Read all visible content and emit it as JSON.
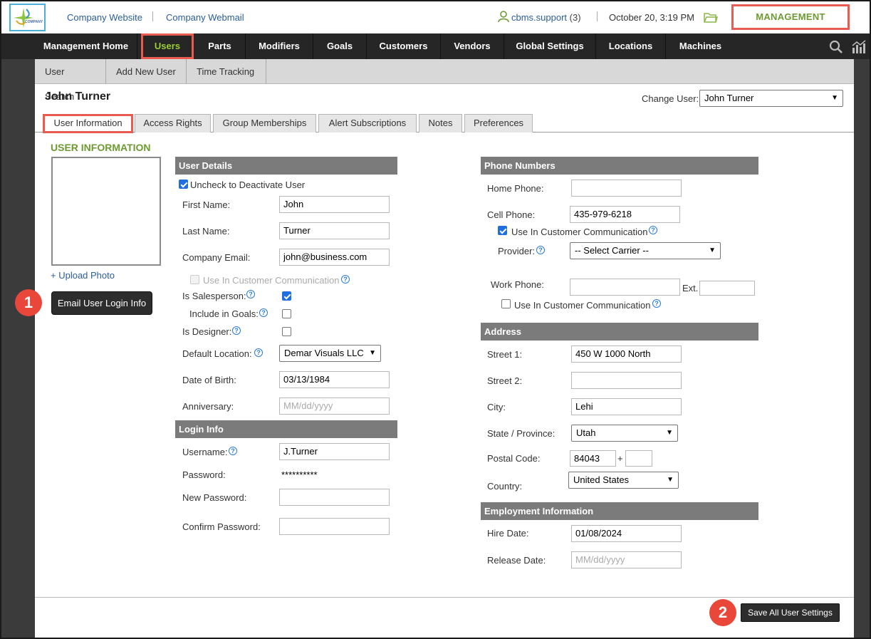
{
  "top": {
    "links": [
      "Company Website",
      "Company Webmail"
    ],
    "user": "cbms.support",
    "user_count": "(3)",
    "datetime": "October 20, 3:19 PM",
    "mode": "MANAGEMENT",
    "logo_text": "COMPANY"
  },
  "nav": {
    "items": [
      "Management Home",
      "Users",
      "Parts",
      "Modifiers",
      "Goals",
      "Customers",
      "Vendors",
      "Global Settings",
      "Locations",
      "Machines"
    ],
    "active": "Users"
  },
  "subnav": [
    "User Search",
    "Add New User",
    "Time Tracking"
  ],
  "page": {
    "user_name": "John Turner",
    "change_user_label": "Change User:",
    "change_user_value": "John Turner"
  },
  "tabs": [
    "User Information",
    "Access Rights",
    "Group Memberships",
    "Alert Subscriptions",
    "Notes",
    "Preferences"
  ],
  "left": {
    "heading": "USER INFORMATION",
    "upload": "+ Upload Photo",
    "email_button": "Email User Login Info"
  },
  "user_details": {
    "title": "User Details",
    "deactivate_label": "Uncheck to Deactivate User",
    "first_name_label": "First Name:",
    "first_name": "John",
    "last_name_label": "Last Name:",
    "last_name": "Turner",
    "email_label": "Company Email:",
    "email": "john@business.com",
    "use_comm_label": "Use In Customer Communication",
    "salesperson_label": "Is Salesperson:",
    "goals_label": "Include in Goals:",
    "designer_label": "Is Designer:",
    "location_label": "Default Location:",
    "location": "Demar Visuals LLC",
    "dob_label": "Date of Birth:",
    "dob": "03/13/1984",
    "anniv_label": "Anniversary:",
    "anniv_placeholder": "MM/dd/yyyy"
  },
  "login_info": {
    "title": "Login Info",
    "username_label": "Username:",
    "username": "J.Turner",
    "password_label": "Password:",
    "password": "**********",
    "new_password_label": "New Password:",
    "confirm_password_label": "Confirm Password:"
  },
  "phone": {
    "title": "Phone Numbers",
    "home_label": "Home Phone:",
    "cell_label": "Cell Phone:",
    "cell": "435-979-6218",
    "use_comm_label": "Use In Customer Communication",
    "provider_label": "Provider:",
    "provider": "-- Select Carrier --",
    "work_label": "Work Phone:",
    "ext_label": "Ext.",
    "work_use_comm_label": "Use In Customer Communication"
  },
  "address": {
    "title": "Address",
    "street1_label": "Street 1:",
    "street1": "450 W 1000 North",
    "street2_label": "Street 2:",
    "city_label": "City:",
    "city": "Lehi",
    "state_label": "State / Province:",
    "state": "Utah",
    "postal_label": "Postal Code:",
    "postal": "84043",
    "plus": "+",
    "country_label": "Country:",
    "country": "United States"
  },
  "employment": {
    "title": "Employment Information",
    "hire_label": "Hire Date:",
    "hire": "01/08/2024",
    "release_label": "Release Date:",
    "release_placeholder": "MM/dd/yyyy"
  },
  "footer": {
    "save_button": "Save All User Settings"
  },
  "badges": [
    "1",
    "2"
  ],
  "colors": {
    "highlight": "#e85b50",
    "accent_green": "#6d9a31",
    "nav_bg": "#262626",
    "link_blue": "#2a5d9a"
  }
}
